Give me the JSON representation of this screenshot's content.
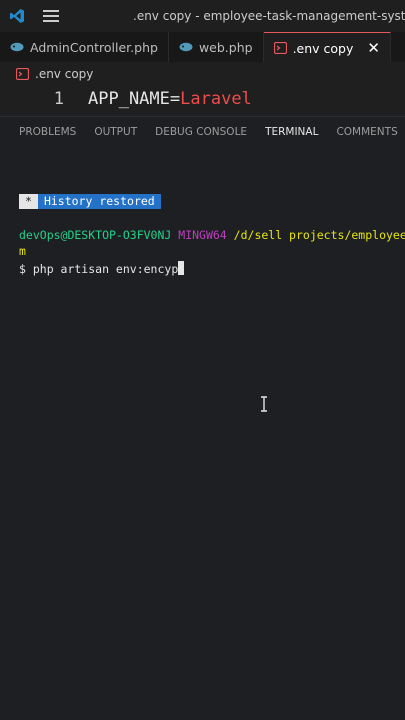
{
  "window": {
    "title": ".env copy - employee-task-management-system - Vis"
  },
  "tabs": [
    {
      "label": "AdminController.php",
      "icon": "php-elephant-icon",
      "icon_color": "#519aba"
    },
    {
      "label": "web.php",
      "icon": "php-elephant-icon",
      "icon_color": "#519aba"
    },
    {
      "label": ".env copy",
      "icon": "env-file-icon",
      "icon_color": "#e8575a",
      "active": true,
      "close": "✕"
    }
  ],
  "breadcrumb": {
    "file": ".env copy",
    "icon": "env-file-icon"
  },
  "editor": {
    "line_number": "1",
    "key": "APP_NAME",
    "equals": "=",
    "value": "Laravel"
  },
  "panel_tabs": [
    "PROBLEMS",
    "OUTPUT",
    "DEBUG CONSOLE",
    "TERMINAL",
    "COMMENTS"
  ],
  "terminal": {
    "history_star": "*",
    "history_message": "History restored",
    "prompt_user": "devOps@DESKTOP-O3FV0NJ",
    "prompt_env": "MINGW64",
    "prompt_path": "/d/sell projects/employee-",
    "prompt_path_wrap": "m",
    "command": "$ php artisan env:encyp"
  },
  "colors": {
    "background": "#1e1f22",
    "accent_active_tab": "#e8575a",
    "history_badge": "#2472c8",
    "prompt_user": "#23d18b",
    "prompt_env": "#bc3fbc",
    "prompt_path": "#e5e510",
    "env_value": "#f14c4c"
  }
}
